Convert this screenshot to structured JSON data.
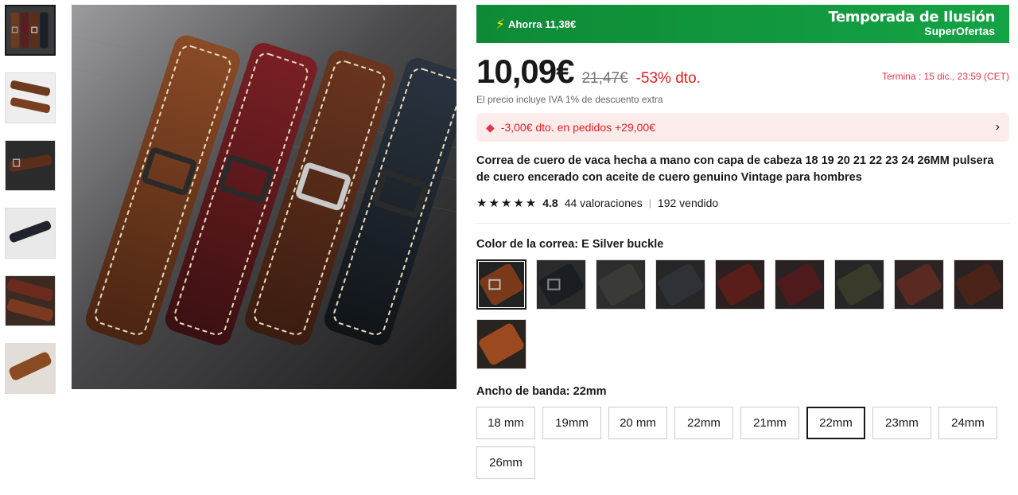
{
  "promo": {
    "save_text": "Ahorra 11,38€",
    "campaign_title": "Temporada de Ilusión",
    "campaign_sub": "SuperOfertas",
    "bg_color": "#14a345"
  },
  "price": {
    "current": "10,09€",
    "original": "21,47€",
    "discount": "-53% dto.",
    "ends": "Termina :  15 dic., 23:59 (CET)",
    "vat_note": "El precio incluye IVA 1% de descuento extra"
  },
  "coupon": {
    "text": "-3,00€ dto. en pedidos +29,00€",
    "icon": "tag-icon"
  },
  "product": {
    "title": "Correa de cuero de vaca hecha a mano con capa de cabeza 18 19 20 21 22 23 24 26MM pulsera de cuero encerado con aceite de cuero genuino Vintage para hombres",
    "stars": "★★★★★",
    "rating": "4.8",
    "reviews": "44 valoraciones",
    "separator": "|",
    "sold": "192 vendido"
  },
  "color_option": {
    "label": "Color de la correa: E Silver buckle",
    "swatches": [
      "brown",
      "black",
      "dark-grey",
      "black-grey",
      "dark-red",
      "wine",
      "olive",
      "chocolate",
      "deep-brown",
      "tan"
    ]
  },
  "size_option": {
    "label": "Ancho de banda: 22mm",
    "sizes": [
      "18 mm",
      "19mm",
      "20 mm",
      "22mm",
      "21mm",
      "22mm",
      "23mm",
      "24mm",
      "26mm"
    ],
    "selected_index": 5
  }
}
